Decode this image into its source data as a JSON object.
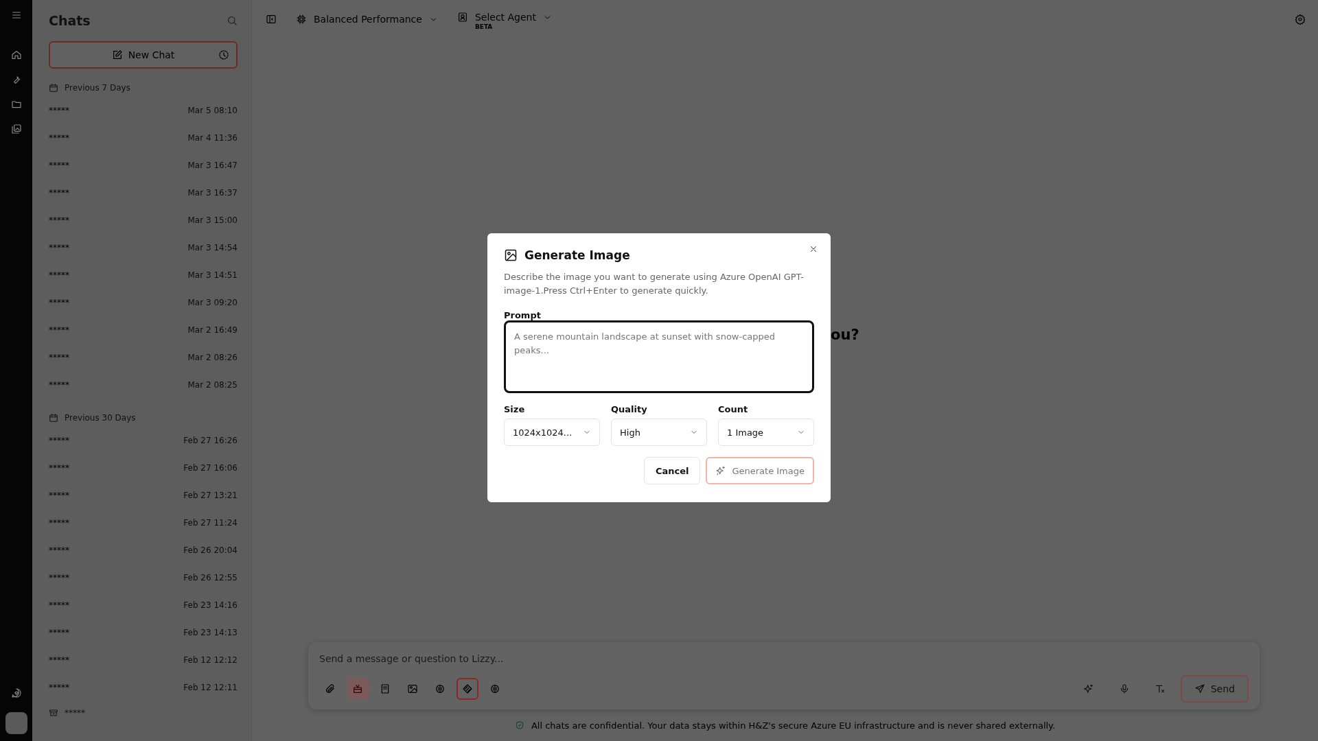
{
  "sidebar": {
    "title": "Chats",
    "new_chat": "New Chat",
    "sections": [
      {
        "label": "Previous 7 Days",
        "chats": [
          {
            "title": "*****",
            "time": "Mar 5 08:10"
          },
          {
            "title": "*****",
            "time": "Mar 4 11:36"
          },
          {
            "title": "*****",
            "time": "Mar 3 16:47"
          },
          {
            "title": "*****",
            "time": "Mar 3 16:37"
          },
          {
            "title": "*****",
            "time": "Mar 3 15:00"
          },
          {
            "title": "*****",
            "time": "Mar 3 14:54"
          },
          {
            "title": "*****",
            "time": "Mar 3 14:51"
          },
          {
            "title": "*****",
            "time": "Mar 3 09:20"
          },
          {
            "title": "*****",
            "time": "Mar 2 16:49"
          },
          {
            "title": "*****",
            "time": "Mar 2 08:26"
          },
          {
            "title": "*****",
            "time": "Mar 2 08:25"
          }
        ]
      },
      {
        "label": "Previous 30 Days",
        "chats": [
          {
            "title": "*****",
            "time": "Feb 27 16:26"
          },
          {
            "title": "*****",
            "time": "Feb 27 16:06"
          },
          {
            "title": "*****",
            "time": "Feb 27 13:21"
          },
          {
            "title": "*****",
            "time": "Feb 27 11:24"
          },
          {
            "title": "*****",
            "time": "Feb 26 20:04"
          },
          {
            "title": "*****",
            "time": "Feb 26 12:55"
          },
          {
            "title": "*****",
            "time": "Feb 23 14:16"
          },
          {
            "title": "*****",
            "time": "Feb 23 14:13"
          },
          {
            "title": "*****",
            "time": "Feb 12 12:12"
          },
          {
            "title": "*****",
            "time": "Feb 12 12:11"
          }
        ]
      }
    ],
    "archive": "*****"
  },
  "toolbar": {
    "model": "Balanced Performance",
    "agent": "Select Agent",
    "agent_badge": "BETA"
  },
  "greeting": "ou?",
  "composer": {
    "placeholder": "Send a message or question to Lizzy...",
    "tools": [
      {
        "on": false,
        "selected": false
      },
      {
        "on": true,
        "selected": false
      },
      {
        "on": false,
        "selected": false
      },
      {
        "on": false,
        "selected": false
      },
      {
        "on": false,
        "selected": false
      },
      {
        "on": false,
        "selected": true
      },
      {
        "on": false,
        "selected": false
      }
    ],
    "send": "Send"
  },
  "notice": "All chats are confidential. Your data stays within H&Z's secure Azure EU infrastructure and is never shared externally.",
  "dialog": {
    "title": "Generate Image",
    "description": "Describe the image you want to generate using Azure OpenAI GPT-image-1.Press Ctrl+Enter to generate quickly.",
    "prompt_label": "Prompt",
    "prompt_placeholder": "A serene mountain landscape at sunset with snow-capped peaks...",
    "selects": [
      {
        "label": "Size",
        "value": "1024x1024..."
      },
      {
        "label": "Quality",
        "value": "High"
      },
      {
        "label": "Count",
        "value": "1 Image"
      }
    ],
    "cancel": "Cancel",
    "generate": "Generate Image"
  }
}
